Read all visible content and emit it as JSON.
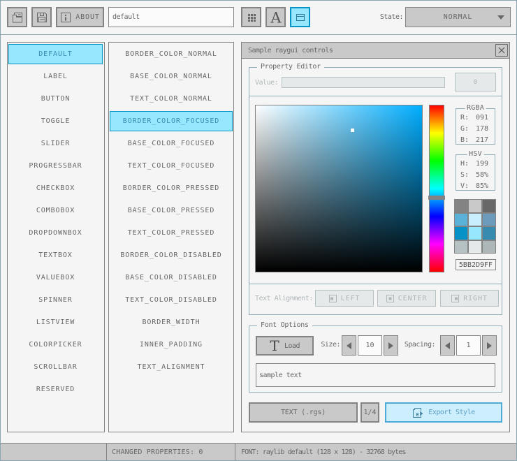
{
  "toolbar": {
    "about_button": "ABOUT",
    "style_name_input": "default",
    "state_label": "State:",
    "state_value": "NORMAL",
    "font_icon_glyph": "A"
  },
  "controls_list": {
    "selected": "DEFAULT",
    "items": [
      "DEFAULT",
      "LABEL",
      "BUTTON",
      "TOGGLE",
      "SLIDER",
      "PROGRESSBAR",
      "CHECKBOX",
      "COMBOBOX",
      "DROPDOWNBOX",
      "TEXTBOX",
      "VALUEBOX",
      "SPINNER",
      "LISTVIEW",
      "COLORPICKER",
      "SCROLLBAR",
      "RESERVED"
    ]
  },
  "properties_list": {
    "selected": "BORDER_COLOR_FOCUSED",
    "items": [
      "BORDER_COLOR_NORMAL",
      "BASE_COLOR_NORMAL",
      "TEXT_COLOR_NORMAL",
      "BORDER_COLOR_FOCUSED",
      "BASE_COLOR_FOCUSED",
      "TEXT_COLOR_FOCUSED",
      "BORDER_COLOR_PRESSED",
      "BASE_COLOR_PRESSED",
      "TEXT_COLOR_PRESSED",
      "BORDER_COLOR_DISABLED",
      "BASE_COLOR_DISABLED",
      "TEXT_COLOR_DISABLED",
      "BORDER_WIDTH",
      "INNER_PADDING",
      "TEXT_ALIGNMENT"
    ]
  },
  "window": {
    "title": "Sample raygui controls"
  },
  "property_editor": {
    "group_label": "Property Editor",
    "value_label": "Value:",
    "value_button": "0",
    "picker": {
      "hue": 199,
      "sat": 58,
      "val": 85,
      "hue_hex": "#00aeff"
    },
    "rgba": {
      "title": "RGBA",
      "rows": [
        {
          "label": "R:",
          "value": "091"
        },
        {
          "label": "G:",
          "value": "178"
        },
        {
          "label": "B:",
          "value": "217"
        }
      ]
    },
    "hsv": {
      "title": "HSV",
      "rows": [
        {
          "label": "H:",
          "value": "199"
        },
        {
          "label": "S:",
          "value": "58%"
        },
        {
          "label": "V:",
          "value": "85%"
        }
      ]
    },
    "palette": [
      "#838383",
      "#c9c9c9",
      "#686868",
      "#5bb2d9",
      "#c9effe",
      "#6c9bbc",
      "#0492c7",
      "#97e8ff",
      "#368baf",
      "#b5c1c2",
      "#e6e9e9",
      "#aeb7b8"
    ],
    "hex_value": "5BB2D9FF",
    "alignment": {
      "label": "Text Alignment:",
      "options": [
        "LEFT",
        "CENTER",
        "RIGHT"
      ]
    }
  },
  "font_options": {
    "group_label": "Font Options",
    "load_button": "Load",
    "load_icon_glyph": "T",
    "size_label": "Size:",
    "size_value": "10",
    "spacing_label": "Spacing:",
    "spacing_value": "1",
    "sample_text": "sample text"
  },
  "footer": {
    "text_button": "TEXT (.rgs)",
    "page_button": "1/4",
    "export_button": "Export Style"
  },
  "status_bar": {
    "changed_properties": "CHANGED PROPERTIES: 0",
    "font_info": "FONT: raylib default (128 x 128) - 32768 bytes"
  },
  "theme": {
    "background": "#f5f5f5",
    "border_normal": "#838383",
    "base_normal": "#c9c9c9",
    "text_normal": "#686868",
    "border_focused": "#5bb2d9",
    "base_focused": "#c9effe",
    "text_focused": "#6c9bbc",
    "border_pressed": "#0492c7",
    "base_pressed": "#97e8ff",
    "text_pressed": "#368baf",
    "border_disabled": "#b5c1c2",
    "base_disabled": "#e6e9e9",
    "text_disabled": "#aeb7b8",
    "line_color": "#90abb5"
  }
}
